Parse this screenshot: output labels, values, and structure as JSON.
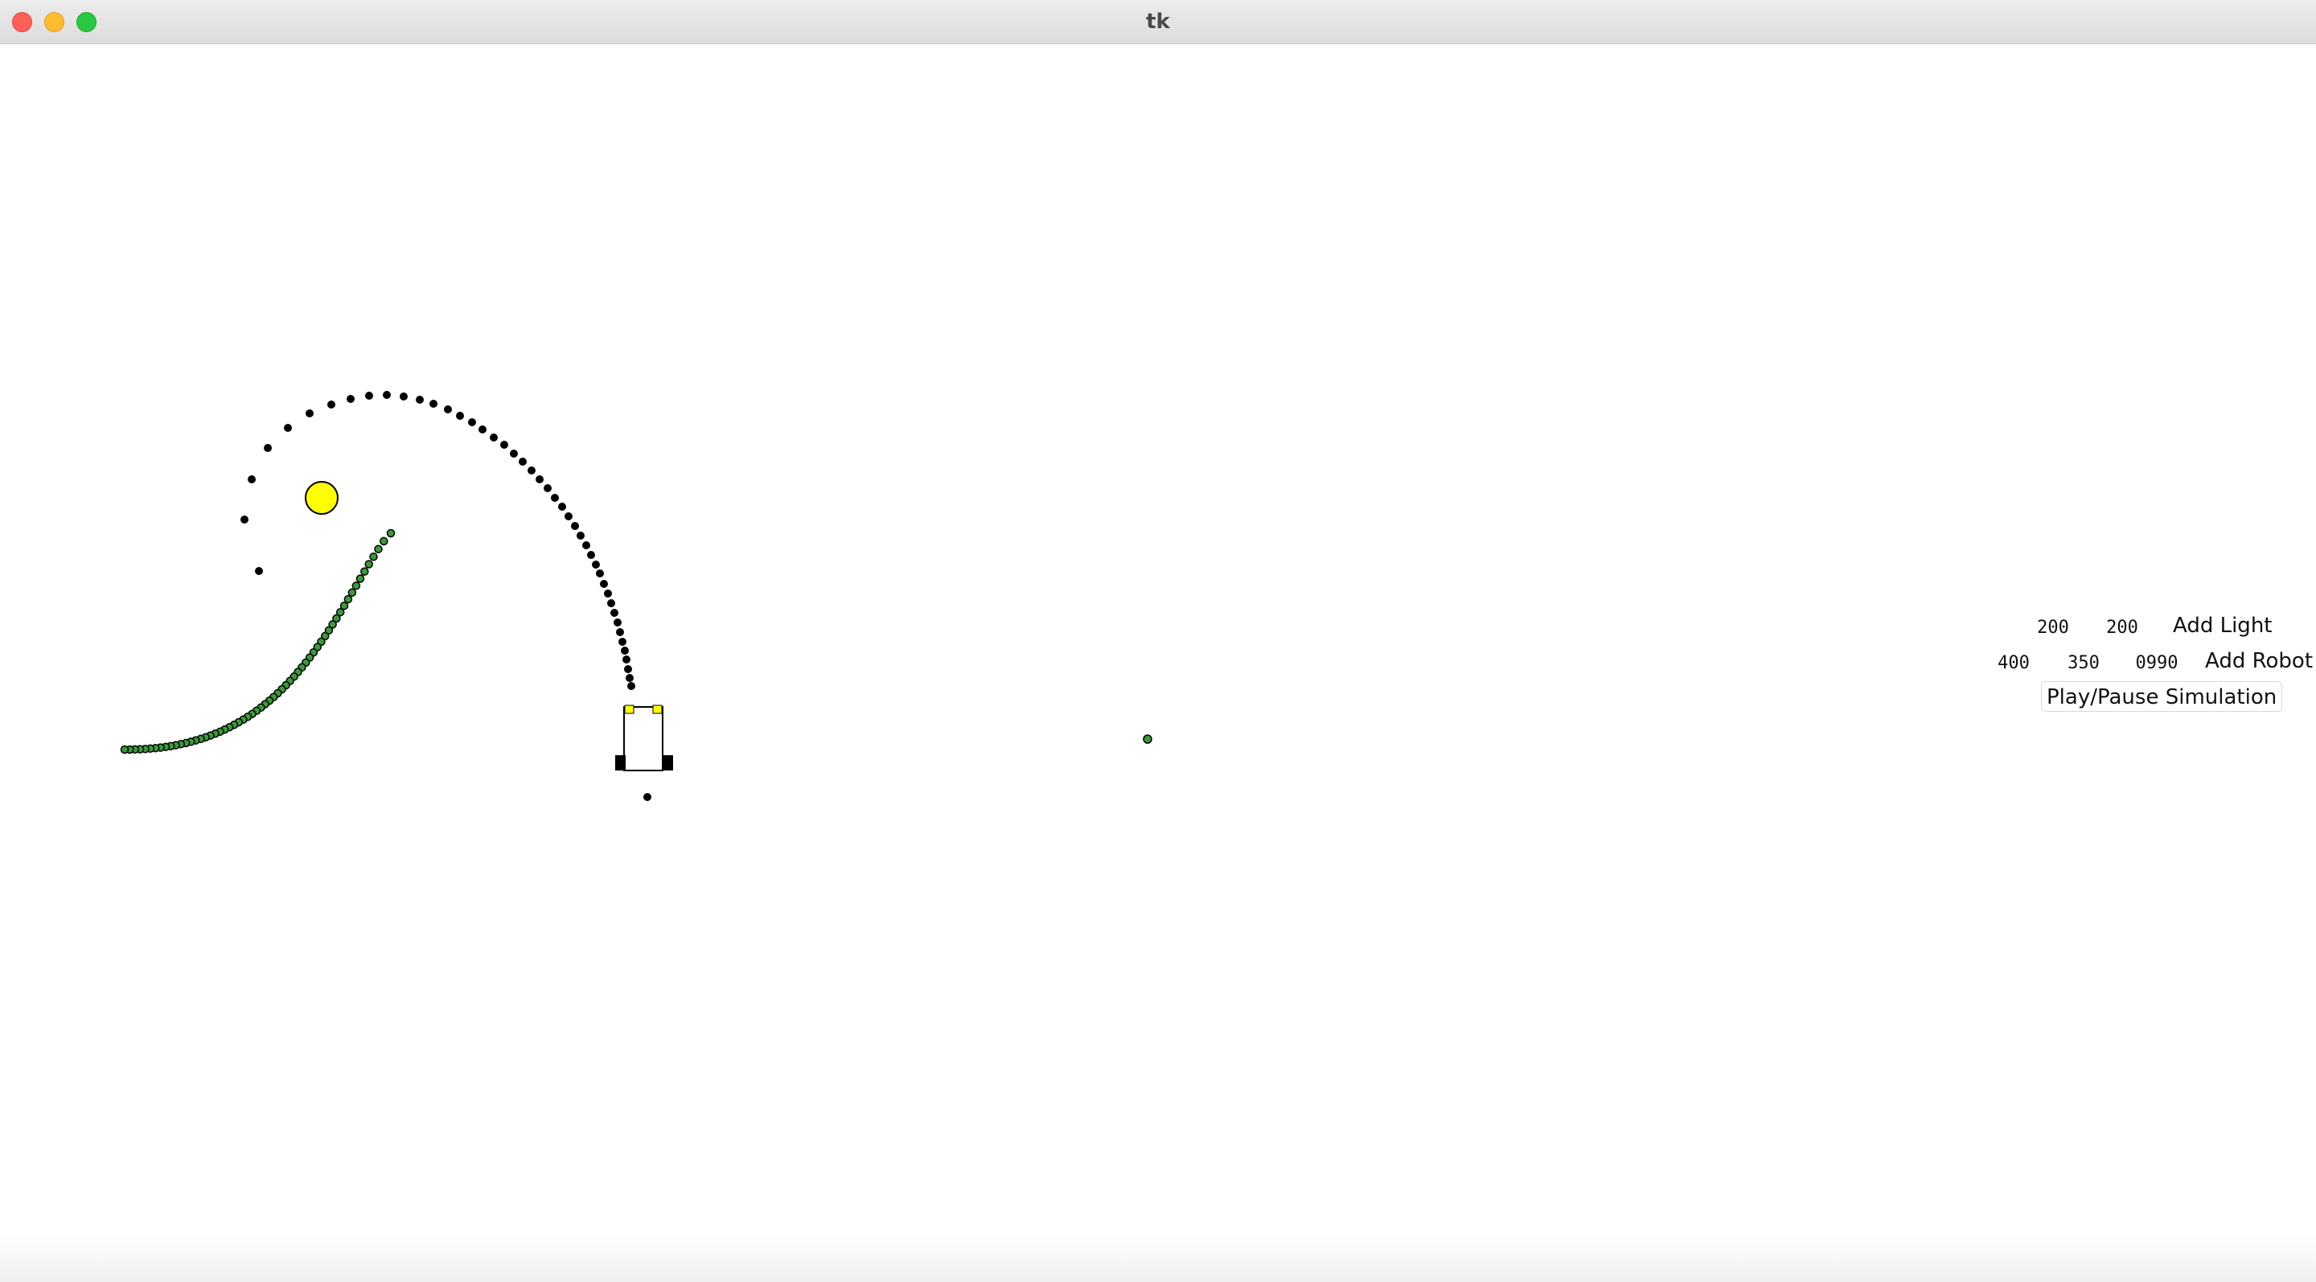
{
  "window": {
    "title": "tk"
  },
  "controls": {
    "light_x": "200",
    "light_y": "200",
    "add_light_label": "Add Light",
    "robot_x": "400",
    "robot_y": "350",
    "robot_param": "0990",
    "add_robot_label": "Add Robot",
    "play_pause_label": "Play/Pause Simulation"
  },
  "colors": {
    "light": "#ffff00",
    "robot_body": "#ffffff",
    "robot_wheels": "#000000",
    "robot_sensors": "#ffff00",
    "trail_black": "#000000",
    "trail_green": "#3a9a3a"
  }
}
